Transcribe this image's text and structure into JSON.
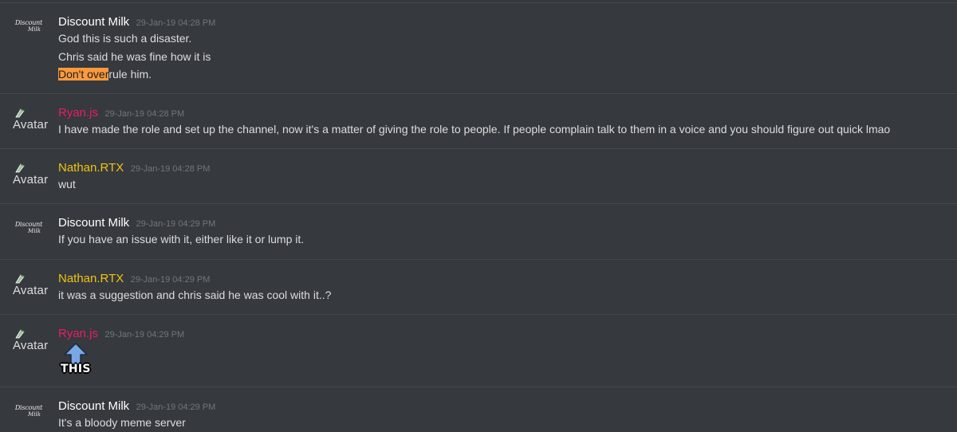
{
  "colors": {
    "background": "#36393e",
    "divider": "#44474d",
    "discount_milk": "#ffffff",
    "ryan": "#e91e63",
    "nathan": "#f1c40f",
    "timestamp": "#72767d",
    "highlight": "#fa9a3d"
  },
  "messages": [
    {
      "author": "Discount Milk",
      "author_color": "#ffffff",
      "avatar": {
        "kind": "logo",
        "text1": "Discount",
        "text2": "Milk"
      },
      "timestamp": "29-Jan-19 04:28 PM",
      "lines": [
        "God this is such a disaster.",
        "Chris said he was fine how it is"
      ],
      "highlighted_line": {
        "highlight": "Don't over",
        "rest": "rule him."
      }
    },
    {
      "author": "Ryan.js",
      "author_color": "#e91e63",
      "avatar": {
        "kind": "broken",
        "alt": "Avatar",
        "icon": "broken-image-icon"
      },
      "timestamp": "29-Jan-19 04:28 PM",
      "lines": [
        "I have made the role and set up the channel, now it's a matter of giving the role to people. If people complain talk to them in a voice and you should figure out quick lmao"
      ]
    },
    {
      "author": "Nathan.RTX",
      "author_color": "#f1c40f",
      "avatar": {
        "kind": "broken",
        "alt": "Avatar",
        "icon": "broken-image-icon"
      },
      "timestamp": "29-Jan-19 04:28 PM",
      "lines": [
        "wut"
      ]
    },
    {
      "author": "Discount Milk",
      "author_color": "#ffffff",
      "avatar": {
        "kind": "logo",
        "text1": "Discount",
        "text2": "Milk"
      },
      "timestamp": "29-Jan-19 04:29 PM",
      "lines": [
        "If you have an issue with it, either like it or lump it."
      ]
    },
    {
      "author": "Nathan.RTX",
      "author_color": "#f1c40f",
      "avatar": {
        "kind": "broken",
        "alt": "Avatar",
        "icon": "broken-image-icon"
      },
      "timestamp": "29-Jan-19 04:29 PM",
      "lines": [
        "it was a suggestion and chris said he was cool with it..?"
      ]
    },
    {
      "author": "Ryan.js",
      "author_color": "#e91e63",
      "avatar": {
        "kind": "broken",
        "alt": "Avatar",
        "icon": "broken-image-icon"
      },
      "timestamp": "29-Jan-19 04:29 PM",
      "lines": []
    },
    {
      "author": "Discount Milk",
      "author_color": "#ffffff",
      "avatar": {
        "kind": "logo",
        "text1": "Discount",
        "text2": "Milk"
      },
      "timestamp": "29-Jan-19 04:29 PM",
      "lines": [
        "It's a bloody meme server"
      ]
    }
  ],
  "annotation": {
    "label": "THIS",
    "icon": "arrow-up-icon",
    "arrow_color": "#7aa7e6"
  }
}
